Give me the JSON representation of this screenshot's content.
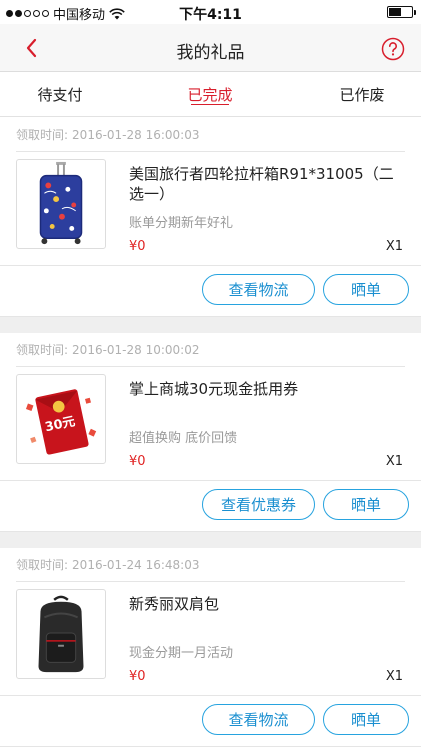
{
  "status_bar": {
    "carrier": "中国移动",
    "time": "下午4:11",
    "battery_level": 0.55
  },
  "nav": {
    "title": "我的礼品",
    "back_icon": "chevron-left-icon",
    "help_icon": "question-circle-icon"
  },
  "tabs": [
    {
      "label": "待支付",
      "active": false
    },
    {
      "label": "已完成",
      "active": true
    },
    {
      "label": "已作废",
      "active": false
    }
  ],
  "accent_color": "#d81e2c",
  "button_color": "#27a3df",
  "orders": [
    {
      "date_label": "领取时间:",
      "date": "2016-01-28 16:00:03",
      "name": "美国旅行者四轮拉杆箱R91*31005（二选一）",
      "subtitle": "账单分期新年好礼",
      "price": "¥0",
      "qty": "X1",
      "btn_primary": "查看物流",
      "btn_secondary": "晒单",
      "image": "suitcase"
    },
    {
      "date_label": "领取时间:",
      "date": "2016-01-28 10:00:02",
      "name": "掌上商城30元现金抵用券",
      "subtitle": "超值换购 底价回馈",
      "price": "¥0",
      "qty": "X1",
      "btn_primary": "查看优惠券",
      "btn_secondary": "晒单",
      "image": "red-envelope",
      "image_text": "30元"
    },
    {
      "date_label": "领取时间:",
      "date": "2016-01-24 16:48:03",
      "name": "新秀丽双肩包",
      "subtitle": "现金分期一月活动",
      "price": "¥0",
      "qty": "X1",
      "btn_primary": "查看物流",
      "btn_secondary": "晒单",
      "image": "backpack"
    }
  ]
}
